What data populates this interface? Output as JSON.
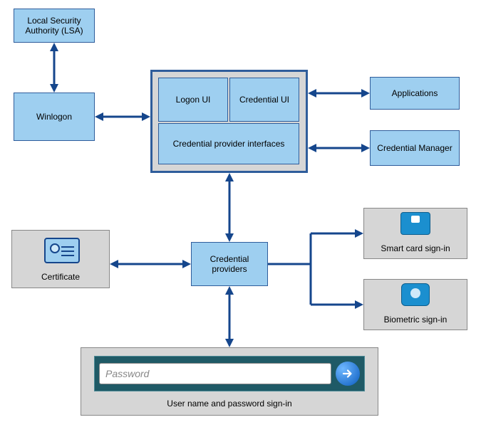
{
  "boxes": {
    "lsa": "Local Security Authority (LSA)",
    "winlogon": "Winlogon",
    "logon_ui": "Logon UI",
    "credential_ui": "Credential UI",
    "cp_interfaces": "Credential provider interfaces",
    "applications": "Applications",
    "cred_manager": "Credential Manager",
    "cred_providers": "Credential providers",
    "certificate": "Certificate",
    "smartcard": "Smart card sign-in",
    "biometric": "Biometric sign-in",
    "password_panel": "User name and password sign-in",
    "password_placeholder": "Password"
  }
}
